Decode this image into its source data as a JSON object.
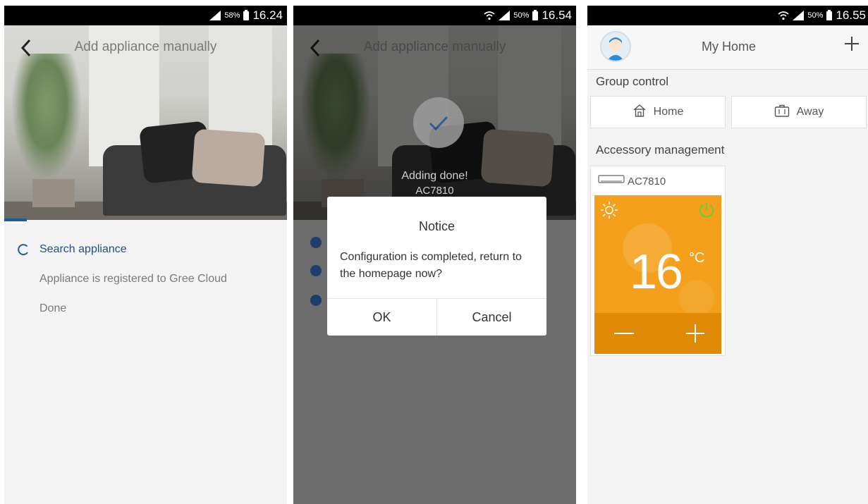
{
  "screen1": {
    "status": {
      "battery": "58%",
      "time": "16.24"
    },
    "title": "Add appliance manually",
    "steps": [
      "Search appliance",
      "Appliance is registered to Gree Cloud",
      "Done"
    ],
    "progress_fraction": 0.08,
    "icons": {
      "back": "back-chevron-icon",
      "spinner": "spinner-icon"
    }
  },
  "screen2": {
    "status": {
      "battery": "50%",
      "time": "16.54"
    },
    "title": "Add appliance manually",
    "adding_text": "Adding done!",
    "device_text": "AC7810",
    "dialog": {
      "title": "Notice",
      "message": "Configuration is completed, return to the homepage now?",
      "ok": "OK",
      "cancel": "Cancel"
    }
  },
  "screen3": {
    "status": {
      "battery": "50%",
      "time": "16.55"
    },
    "title": "My Home",
    "group_control_label": "Group control",
    "home_button": "Home",
    "away_button": "Away",
    "accessory_label": "Accessory management",
    "device": {
      "name": "AC7810",
      "temperature": "16",
      "unit": "°C"
    },
    "colors": {
      "panel": "#f4a01c",
      "power": "#5dd23a",
      "accent": "#1f5a9e"
    }
  }
}
